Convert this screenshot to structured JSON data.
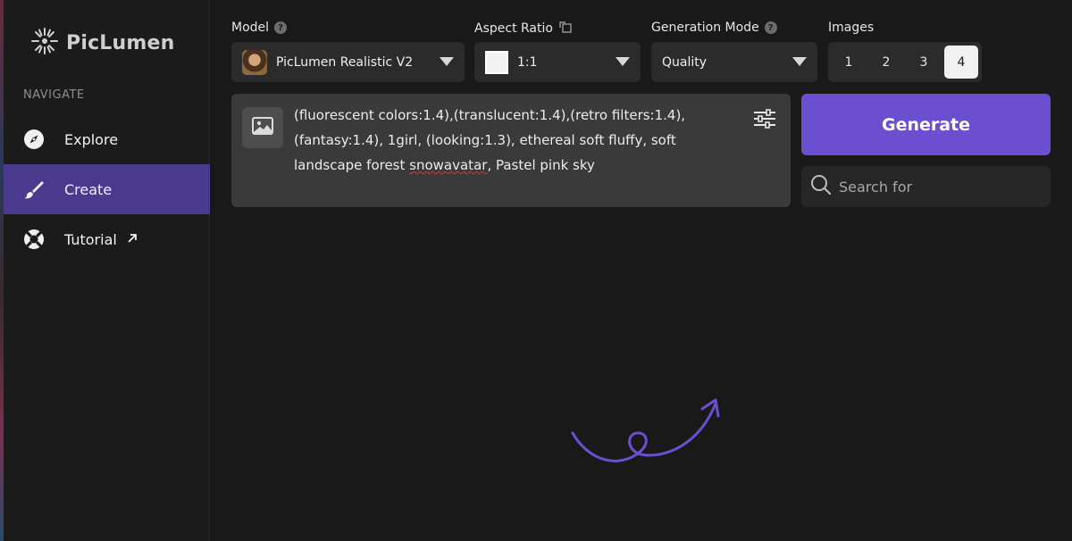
{
  "app": {
    "logo_text": "PicLumen"
  },
  "sidebar": {
    "section_title": "NAVIGATE",
    "items": [
      {
        "label": "Explore",
        "icon": "compass-icon",
        "active": false
      },
      {
        "label": "Create",
        "icon": "brush-icon",
        "active": true
      },
      {
        "label": "Tutorial",
        "icon": "lifebuoy-icon",
        "active": false,
        "external": true
      }
    ]
  },
  "controls": {
    "model": {
      "label": "Model",
      "value": "PicLumen Realistic V2"
    },
    "aspect_ratio": {
      "label": "Aspect Ratio",
      "value": "1:1"
    },
    "generation_mode": {
      "label": "Generation Mode",
      "value": "Quality"
    },
    "images": {
      "label": "Images",
      "options": [
        "1",
        "2",
        "3",
        "4"
      ],
      "selected": "4"
    }
  },
  "prompt": {
    "line1": "(fluorescent colors:1.4),(translucent:1.4),(retro filters:1.4),",
    "line2": "(fantasy:1.4), 1girl, (looking:1.3), ethereal soft fluffy, soft",
    "line3_before": "landscape forest ",
    "line3_misspelled": "snowavatar",
    "line3_after": ", Pastel pink sky"
  },
  "actions": {
    "generate_label": "Generate",
    "search_placeholder": "Search for"
  },
  "colors": {
    "accent": "#6b4fd1",
    "active_nav": "#4a3a8e",
    "background": "#191919"
  }
}
